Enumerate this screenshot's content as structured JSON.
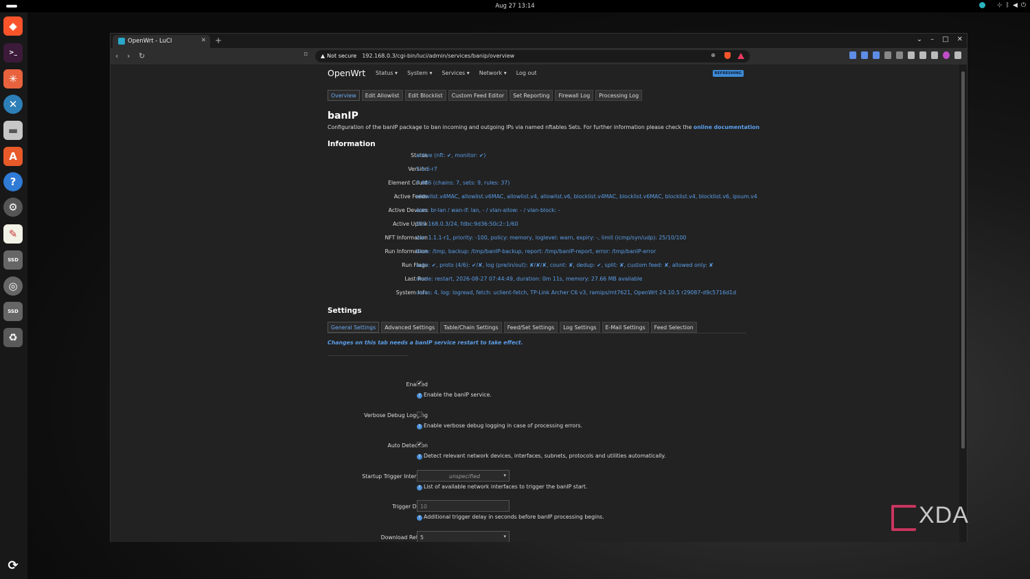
{
  "topbar": {
    "clock": "Aug 27  13:14"
  },
  "dock": {
    "items": [
      "brave",
      "terminal",
      "app-1",
      "app-2",
      "files",
      "app-center",
      "help",
      "settings",
      "text-editor",
      "ssd-1",
      "disc",
      "ssd-2",
      "trash"
    ]
  },
  "browser": {
    "tab_title": "OpenWrt - LuCI",
    "new_tab": "+",
    "url_security": "Not secure",
    "url": "192.168.0.3/cgi-bin/luci/admin/services/banip/overview"
  },
  "luci": {
    "brand": "OpenWrt",
    "menu": [
      "Status ▾",
      "System ▾",
      "Services ▾",
      "Network ▾",
      "Log out"
    ],
    "refresh_badge": "REFRESHING",
    "subtabs": [
      "Overview",
      "Edit Allowlist",
      "Edit Blocklist",
      "Custom Feed Editor",
      "Set Reporting",
      "Firewall Log",
      "Processing Log"
    ],
    "title": "banIP",
    "description": "Configuration of the banIP package to ban incoming and outgoing IPs via named nftables Sets. For further information please check the ",
    "doc_link": "online documentation",
    "info_heading": "Information",
    "info": [
      {
        "label": "Status",
        "value": "active (nft: ✔, monitor: ✔)"
      },
      {
        "label": "Version",
        "value": "1.5.6-r7"
      },
      {
        "label": "Element Count",
        "value": "7 686 (chains: 7, sets: 9, rules: 37)"
      },
      {
        "label": "Active Feeds",
        "value": "allowlist.v4MAC, allowlist.v6MAC, allowlist.v4, allowlist.v6, blocklist.v4MAC, blocklist.v6MAC, blocklist.v4, blocklist.v6, ipsum.v4"
      },
      {
        "label": "Active Devices",
        "value": "wan: br-lan / wan-if: lan, - / vlan-allow: - / vlan-block: -"
      },
      {
        "label": "Active Uplink",
        "value": "192.168.0.3/24, fdbc:9d36:50c2::1/60"
      },
      {
        "label": "NFT Information",
        "value": "ver: 1.1.1-r1, priority: -100, policy: memory, loglevel: warn, expiry: -, limit (icmp/syn/udp): 25/10/100"
      },
      {
        "label": "Run Information",
        "value": "base: /tmp, backup: /tmp/banIP-backup, report: /tmp/banIP-report, error: /tmp/banIP-error"
      },
      {
        "label": "Run Flags",
        "value": "auto: ✔, proto (4/6): ✔/✘, log (pre/in/out): ✘/✘/✘, count: ✘, dedup: ✔, split: ✘, custom feed: ✘, allowed only: ✘"
      },
      {
        "label": "Last Run",
        "value": "mode: restart, 2026-08-27 07:44:49, duration: 0m 11s, memory: 27.66 MB available"
      },
      {
        "label": "System Info",
        "value": "cores: 4, log: logread, fetch: uclient-fetch, TP-Link Archer C6 v3, ramips/mt7621, OpenWrt 24.10.5 r29087-d9c5716d1d"
      }
    ],
    "settings_heading": "Settings",
    "settings_tabs": [
      "General Settings",
      "Advanced Settings",
      "Table/Chain Settings",
      "Feed/Set Settings",
      "Log Settings",
      "E-Mail Settings",
      "Feed Selection"
    ],
    "note": "Changes on this tab needs a banIP service restart to take effect.",
    "options": [
      {
        "label": "Enabled",
        "type": "checkbox",
        "checked": "✔",
        "hint": "Enable the banIP service."
      },
      {
        "label": "Verbose Debug Logging",
        "type": "checkbox",
        "checked": "",
        "hint": "Enable verbose debug logging in case of processing errors."
      },
      {
        "label": "Auto Detection",
        "type": "checkbox",
        "checked": "✔",
        "hint": "Detect relevant network devices, interfaces, subnets, protocols and utilities automatically."
      },
      {
        "label": "Startup Trigger Interface",
        "type": "select",
        "value": "unspecified",
        "hint": "List of available network interfaces to trigger the banIP start."
      },
      {
        "label": "Trigger Delay",
        "type": "input",
        "value": "10",
        "hint": "Additional trigger delay in seconds before banIP processing begins."
      },
      {
        "label": "Download Retries",
        "type": "select",
        "value": "5",
        "hint": ""
      }
    ]
  },
  "watermark": "XDA"
}
